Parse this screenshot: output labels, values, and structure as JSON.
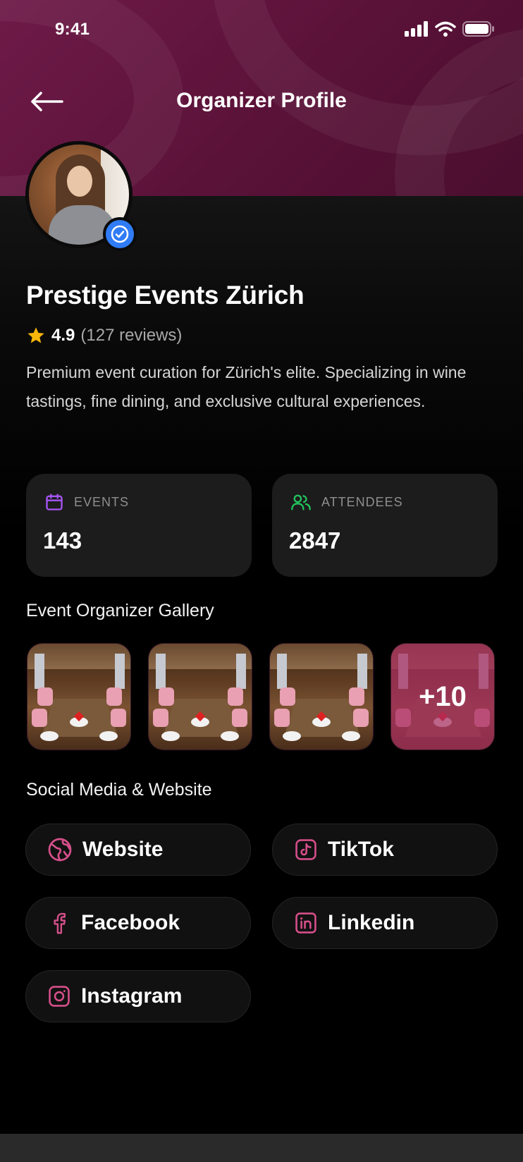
{
  "status_bar": {
    "time": "9:41"
  },
  "nav": {
    "title": "Organizer Profile"
  },
  "organizer": {
    "name": "Prestige Events Zürich",
    "rating": "4.9",
    "reviews": "(127 reviews)",
    "description": "Premium event curation for Zürich's elite. Specializing in wine tastings, fine dining, and exclusive cultural experiences."
  },
  "stats": [
    {
      "label": "EVENTS",
      "value": "143",
      "icon": "calendar-icon",
      "color": "#a855f7"
    },
    {
      "label": "ATTENDEES",
      "value": "2847",
      "icon": "users-icon",
      "color": "#22c55e"
    }
  ],
  "gallery": {
    "title": "Event Organizer Gallery",
    "more_label": "+10"
  },
  "social": {
    "title": "Social Media & Website",
    "items": [
      {
        "label": "Website",
        "icon": "globe-icon"
      },
      {
        "label": "TikTok",
        "icon": "tiktok-icon"
      },
      {
        "label": "Facebook",
        "icon": "facebook-icon"
      },
      {
        "label": "Linkedin",
        "icon": "linkedin-icon"
      },
      {
        "label": "Instagram",
        "icon": "instagram-icon"
      }
    ]
  },
  "colors": {
    "accent": "#d64f8a",
    "header": "#5a1238",
    "verified": "#2f7cf6",
    "star": "#f5b50a"
  }
}
